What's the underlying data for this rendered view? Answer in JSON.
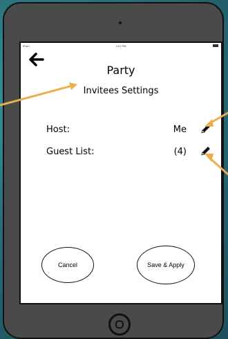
{
  "status": {
    "carrier": "iPad •",
    "time": "4:21 PM"
  },
  "header": {
    "back_icon": "arrow-left-icon",
    "title": "Party",
    "subtitle": "Invitees Settings"
  },
  "rows": [
    {
      "label": "Host:",
      "value": "Me",
      "edit_icon": "pencil-icon"
    },
    {
      "label": "Guest List:",
      "value": "(4)",
      "edit_icon": "pencil-icon"
    }
  ],
  "buttons": {
    "cancel": "Cancel",
    "save": "Save & Apply"
  },
  "colors": {
    "annotation_arrow": "#e8b04a",
    "background": "#2a6f7a",
    "device": "#4a4a4a"
  }
}
